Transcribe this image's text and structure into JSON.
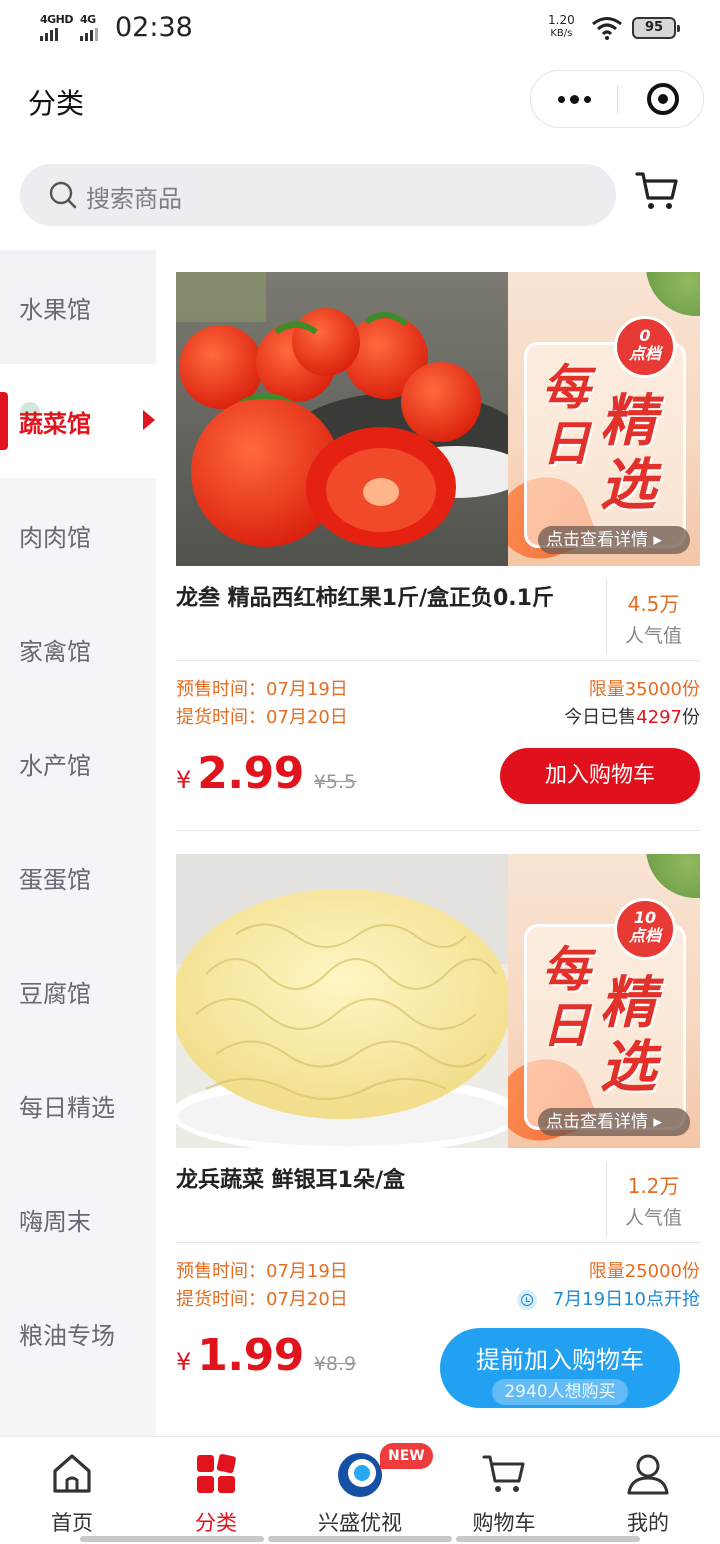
{
  "status_bar": {
    "net1": "4GHD",
    "net2": "4G",
    "time": "02:38",
    "speed_value": "1.20",
    "speed_unit": "KB/s",
    "battery": "95"
  },
  "header": {
    "title": "分类"
  },
  "search": {
    "placeholder": "搜索商品"
  },
  "sidebar": {
    "items": [
      {
        "label": "水果馆"
      },
      {
        "label": "蔬菜馆",
        "active": true
      },
      {
        "label": "肉肉馆"
      },
      {
        "label": "家禽馆"
      },
      {
        "label": "水产馆"
      },
      {
        "label": "蛋蛋馆"
      },
      {
        "label": "豆腐馆"
      },
      {
        "label": "每日精选"
      },
      {
        "label": "嗨周末"
      },
      {
        "label": "粮油专场"
      }
    ]
  },
  "products": [
    {
      "banner_badge_line1": "0",
      "banner_badge_line2": "点档",
      "banner_text1": "每日",
      "banner_text2": "精选",
      "banner_detail": "点击查看详情 ▸",
      "title": "龙叁 精品西红柿红果1斤/盒正负0.1斤",
      "pop_num": "4.5万",
      "pop_label": "人气值",
      "presale": "预售时间：07月19日",
      "pickup": "提货时间：07月20日",
      "limit": "限量35000份",
      "sold_prefix": "今日已售",
      "sold_count": "4297",
      "sold_suffix": "份",
      "currency": "¥",
      "price": "2.99",
      "old_price": "¥5.5",
      "button": "加入购物车",
      "button_color": "#e0101c"
    },
    {
      "banner_badge_line1": "10",
      "banner_badge_line2": "点档",
      "banner_text1": "每日",
      "banner_text2": "精选",
      "banner_detail": "点击查看详情 ▸",
      "title": "龙兵蔬菜 鲜银耳1朵/盒",
      "pop_num": "1.2万",
      "pop_label": "人气值",
      "presale": "预售时间：07月19日",
      "pickup": "提货时间：07月20日",
      "limit": "限量25000份",
      "start_time": "7月19日10点开抢",
      "currency": "¥",
      "price": "1.99",
      "old_price": "¥8.9",
      "button": "提前加入购物车",
      "button_sub": "2940人想购买",
      "button_color": "#22a0f2"
    }
  ],
  "tabbar": {
    "items": [
      {
        "label": "首页",
        "icon": "home-icon"
      },
      {
        "label": "分类",
        "icon": "category-icon",
        "active": true
      },
      {
        "label": "兴盛优视",
        "icon": "video-icon",
        "badge": "NEW"
      },
      {
        "label": "购物车",
        "icon": "cart-icon"
      },
      {
        "label": "我的",
        "icon": "profile-icon"
      }
    ]
  },
  "colors": {
    "accent_red": "#e1141e",
    "accent_orange": "#e56d22",
    "accent_blue": "#22a0f2"
  }
}
